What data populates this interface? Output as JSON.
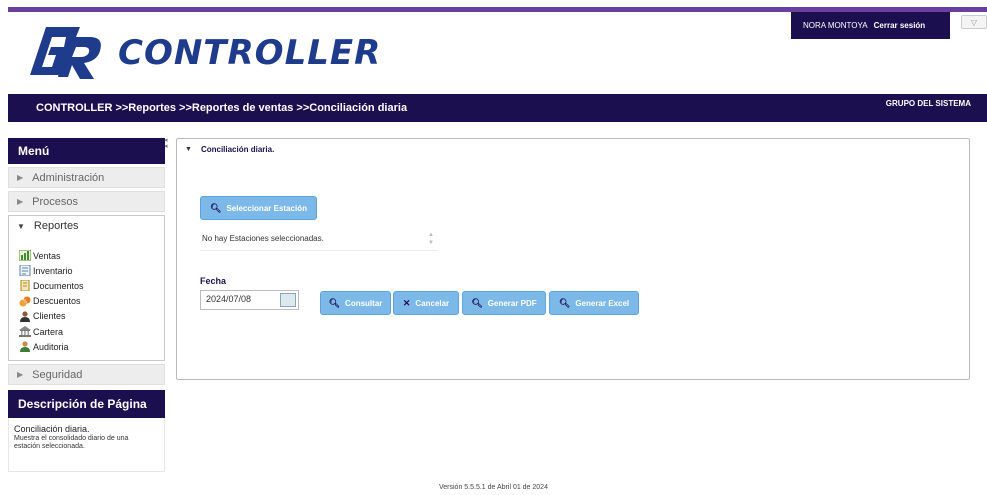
{
  "header": {
    "logo_text": "CONTROLLER",
    "user_name": "NORA MONTOYA",
    "logout_label": "Cerrar sesión",
    "corner_button": "▽",
    "breadcrumb": "CONTROLLER >>Reportes >>Reportes de ventas >>Conciliación diaria",
    "group": "GRUPO DEL SISTEMA",
    "brand_color": "#1c0f4f",
    "accent_color": "#6b3fa0"
  },
  "sidebar": {
    "menu_title": "Menú",
    "sections": [
      {
        "label": "Administración",
        "expanded": false
      },
      {
        "label": "Procesos",
        "expanded": false
      },
      {
        "label": "Reportes",
        "expanded": true
      },
      {
        "label": "Seguridad",
        "expanded": false
      }
    ],
    "reportes_items": [
      {
        "label": "Ventas",
        "icon": "sales-report-icon"
      },
      {
        "label": "Inventario",
        "icon": "inventory-icon"
      },
      {
        "label": "Documentos",
        "icon": "documents-icon"
      },
      {
        "label": "Descuentos",
        "icon": "discounts-icon"
      },
      {
        "label": "Clientes",
        "icon": "clients-icon"
      },
      {
        "label": "Cartera",
        "icon": "portfolio-icon"
      },
      {
        "label": "Auditoria",
        "icon": "audit-icon"
      }
    ],
    "description_title": "Descripción de Página",
    "description_page": "Conciliación diaria.",
    "description_text": "Muestra el consolidado diario de una estación seleccionada."
  },
  "panel": {
    "title": "Conciliación diaria.",
    "select_station_label": "Seleccionar Estación",
    "stations_empty": "No hay Estaciones seleccionadas.",
    "date_label": "Fecha",
    "date_value": "2024/07/08",
    "buttons": {
      "consultar": "Consultar",
      "cancelar": "Cancelar",
      "pdf": "Generar PDF",
      "excel": "Generar Excel"
    },
    "button_color": "#7db9e8"
  },
  "footer": {
    "version": "Versión 5.5.5.1 de Abril 01 de 2024"
  }
}
